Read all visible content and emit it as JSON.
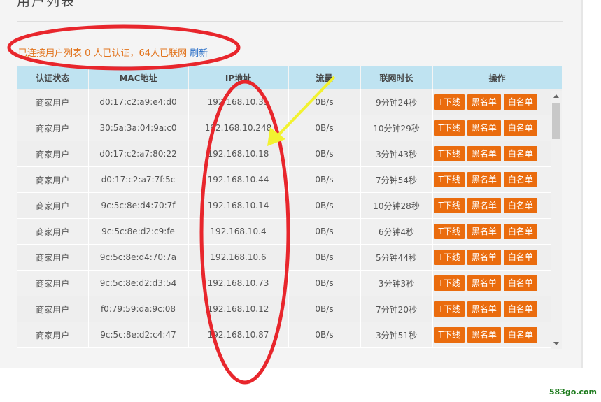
{
  "page": {
    "title": "用户列表",
    "notice_text": "已连接用户列表 0 人已认证，64人已联网",
    "refresh_label": "刷新"
  },
  "table": {
    "headers": [
      "认证状态",
      "MAC地址",
      "IP地址",
      "流量",
      "联网时长",
      "操作"
    ],
    "rows": [
      {
        "status": "商家用户",
        "mac": "d0:17:c2:a9:e4:d0",
        "ip": "192.168.10.35",
        "traffic": "0B/s",
        "duration": "9分钟24秒"
      },
      {
        "status": "商家用户",
        "mac": "30:5a:3a:04:9a:c0",
        "ip": "192.168.10.248",
        "traffic": "0B/s",
        "duration": "10分钟29秒"
      },
      {
        "status": "商家用户",
        "mac": "d0:17:c2:a7:80:22",
        "ip": "192.168.10.18",
        "traffic": "0B/s",
        "duration": "3分钟43秒"
      },
      {
        "status": "商家用户",
        "mac": "d0:17:c2:a7:7f:5c",
        "ip": "192.168.10.44",
        "traffic": "0B/s",
        "duration": "7分钟54秒"
      },
      {
        "status": "商家用户",
        "mac": "9c:5c:8e:d4:70:7f",
        "ip": "192.168.10.14",
        "traffic": "0B/s",
        "duration": "10分钟28秒"
      },
      {
        "status": "商家用户",
        "mac": "9c:5c:8e:d2:c9:fe",
        "ip": "192.168.10.4",
        "traffic": "0B/s",
        "duration": "6分钟4秒"
      },
      {
        "status": "商家用户",
        "mac": "9c:5c:8e:d4:70:7a",
        "ip": "192.168.10.6",
        "traffic": "0B/s",
        "duration": "5分钟44秒"
      },
      {
        "status": "商家用户",
        "mac": "9c:5c:8e:d2:d3:54",
        "ip": "192.168.10.73",
        "traffic": "0B/s",
        "duration": "3分钟3秒"
      },
      {
        "status": "商家用户",
        "mac": "f0:79:59:da:9c:08",
        "ip": "192.168.10.12",
        "traffic": "0B/s",
        "duration": "7分钟20秒"
      },
      {
        "status": "商家用户",
        "mac": "9c:5c:8e:d2:c4:47",
        "ip": "192.168.10.87",
        "traffic": "0B/s",
        "duration": "3分钟51秒"
      }
    ],
    "actions": [
      "T下线",
      "黑名单",
      "白名单"
    ]
  },
  "watermark": "583go.com",
  "colors": {
    "header_bg": "#bfe3f1",
    "button_bg": "#ea6c0e",
    "notice_text": "#e2731c",
    "refresh_link": "#2a6fc7",
    "annotation_red": "#e8262c",
    "annotation_yellow": "#f2f230"
  }
}
